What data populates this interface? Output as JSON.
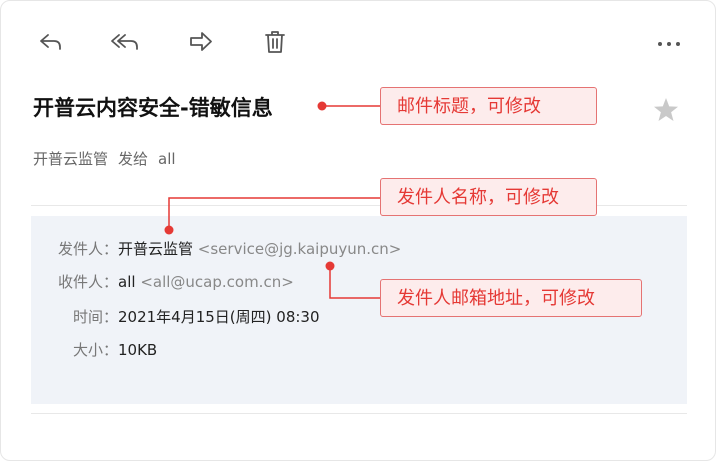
{
  "toolbar": {
    "reply_icon": "reply-icon",
    "reply_all_icon": "reply-all-icon",
    "forward_icon": "forward-icon",
    "delete_icon": "trash-icon",
    "more_icon": "more-icon"
  },
  "email": {
    "subject": "开普云内容安全-错敏信息",
    "sender_name": "开普云监管",
    "sent_to_word": "发给",
    "recipient_short": "all",
    "details": {
      "from_label": "发件人：",
      "from_name": "开普云监管",
      "from_address": "<service@jg.kaipuyun.cn>",
      "to_label": "收件人：",
      "to_name": "all",
      "to_address": "<all@ucap.com.cn>",
      "time_label": "时间：",
      "time_value": "2021年4月15日(周四) 08:30",
      "size_label": "大小：",
      "size_value": "10KB"
    }
  },
  "annotations": {
    "subject_note": "邮件标题，可修改",
    "sender_name_note": "发件人名称，可修改",
    "sender_address_note": "发件人邮箱地址，可修改"
  },
  "colors": {
    "annotation_red": "#e53935",
    "annotation_bg": "#fdecec",
    "details_bg": "#f0f3f8"
  }
}
